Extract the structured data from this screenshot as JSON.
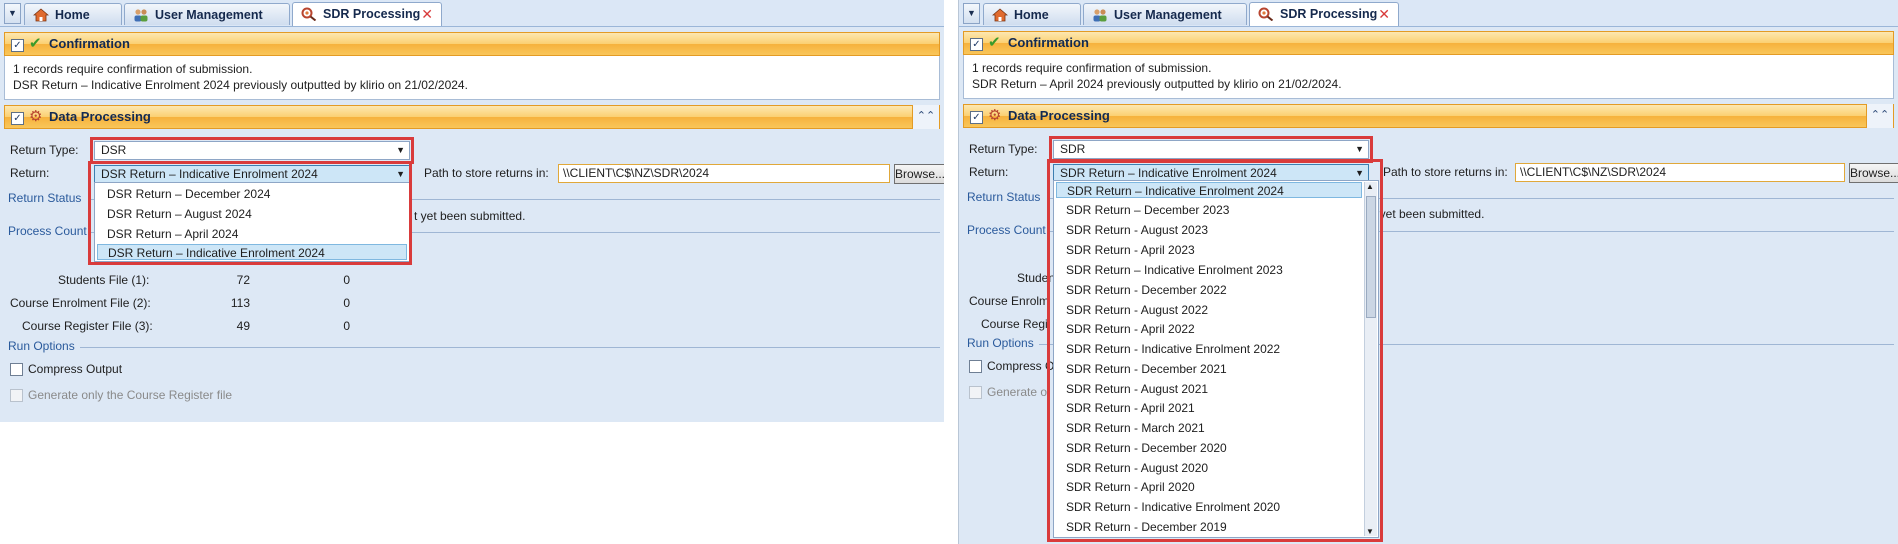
{
  "tabs": [
    {
      "label": "Home",
      "icon": "home-icon"
    },
    {
      "label": "User Management",
      "icon": "users-icon"
    },
    {
      "label": "SDR Processing",
      "icon": "sdr-processing-icon",
      "close": "✕"
    }
  ],
  "confirmation": {
    "title": "Confirmation",
    "line1": "1 records require confirmation of submission.",
    "left_line2": "DSR Return – Indicative Enrolment 2024 previously outputted by klirio on 21/02/2024.",
    "right_line2": "SDR Return – April 2024 previously outputted by klirio on 21/02/2024."
  },
  "data_processing": {
    "title": "Data Processing",
    "return_type_label": "Return Type:",
    "return_label": "Return:",
    "path_label": "Path to store returns in:",
    "path_value": "\\\\CLIENT\\C$\\NZ\\SDR\\2024",
    "browse_label": "Browse...",
    "return_status_label": "Return Status",
    "process_count_label": "Process Count",
    "not_submitted_text": "t yet been submitted.",
    "run_options_label": "Run Options",
    "compress_label": "Compress Output",
    "generate_label": "Generate only the Course Register file"
  },
  "left": {
    "return_type_value": "DSR",
    "return_value": "DSR Return – Indicative Enrolment 2024",
    "options": [
      "DSR Return – December 2024",
      "DSR Return – August 2024",
      "DSR Return – April 2024",
      "DSR Return – Indicative Enrolment 2024"
    ],
    "selected_index": 3,
    "counts": [
      {
        "label": "Students File (1):",
        "a": "72",
        "b": "0"
      },
      {
        "label": "Course Enrolment File (2):",
        "a": "113",
        "b": "0"
      },
      {
        "label": "Course Register File (3):",
        "a": "49",
        "b": "0"
      }
    ]
  },
  "right": {
    "return_type_value": "SDR",
    "return_value": "SDR Return – Indicative Enrolment 2024",
    "options": [
      "SDR Return – Indicative Enrolment 2024",
      "SDR Return – December 2023",
      "SDR Return - August 2023",
      "SDR Return - April 2023",
      "SDR Return – Indicative Enrolment 2023",
      "SDR Return - December 2022",
      "SDR Return - August 2022",
      "SDR Return - April 2022",
      "SDR Return - Indicative Enrolment 2022",
      "SDR Return - December 2021",
      "SDR Return - August 2021",
      "SDR Return - April 2021",
      "SDR Return - March 2021",
      "SDR Return - December 2020",
      "SDR Return - August 2020",
      "SDR Return - April 2020",
      "SDR Return - Indicative Enrolment 2020",
      "SDR Return - December 2019"
    ],
    "selected_index": 0,
    "partial_labels": [
      "Studen",
      "Course Enrolm",
      "Course Regi"
    ],
    "compress_partial": "Compress O",
    "generate_partial": "Generate o"
  },
  "colors": {
    "accent_orange": "#f6b23d",
    "highlight_red": "#d93b3b",
    "panel_blue": "#dde8f5"
  }
}
